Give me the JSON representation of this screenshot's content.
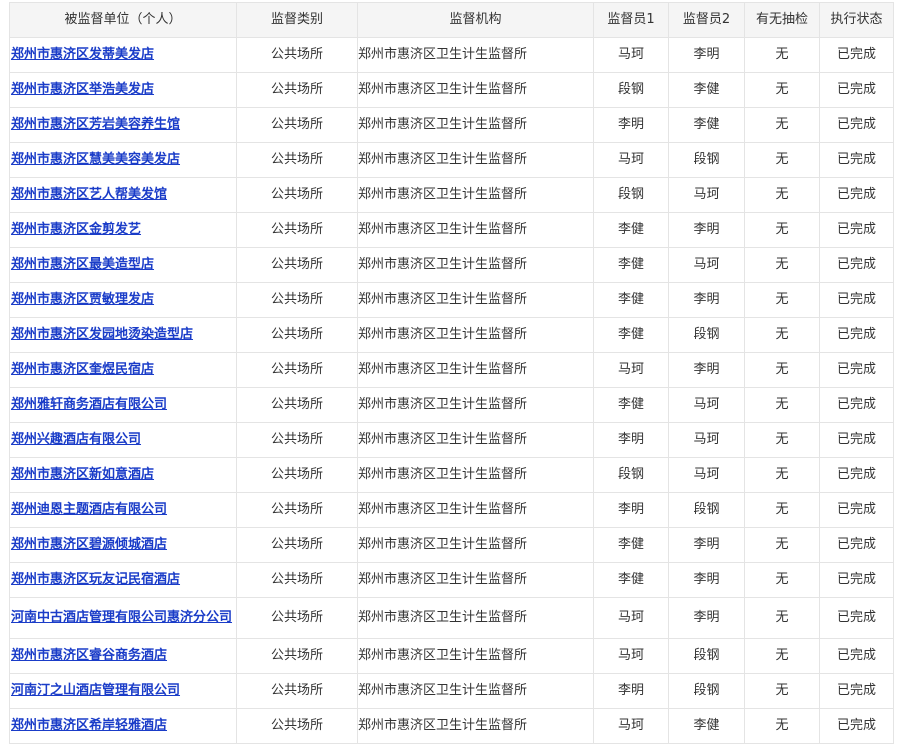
{
  "headers": [
    "被监督单位（个人）",
    "监督类别",
    "监督机构",
    "监督员1",
    "监督员2",
    "有无抽检",
    "执行状态"
  ],
  "rows": [
    {
      "name": "郑州市惠济区发蒂美发店",
      "category": "公共场所",
      "org": "郑州市惠济区卫生计生监督所",
      "inspector1": "马珂",
      "inspector2": "李明",
      "sampling": "无",
      "status": "已完成"
    },
    {
      "name": "郑州市惠济区举浩美发店",
      "category": "公共场所",
      "org": "郑州市惠济区卫生计生监督所",
      "inspector1": "段钢",
      "inspector2": "李健",
      "sampling": "无",
      "status": "已完成"
    },
    {
      "name": "郑州市惠济区芳岩美容养生馆",
      "category": "公共场所",
      "org": "郑州市惠济区卫生计生监督所",
      "inspector1": "李明",
      "inspector2": "李健",
      "sampling": "无",
      "status": "已完成"
    },
    {
      "name": "郑州市惠济区慧美美容美发店",
      "category": "公共场所",
      "org": "郑州市惠济区卫生计生监督所",
      "inspector1": "马珂",
      "inspector2": "段钢",
      "sampling": "无",
      "status": "已完成"
    },
    {
      "name": "郑州市惠济区艺人帮美发馆",
      "category": "公共场所",
      "org": "郑州市惠济区卫生计生监督所",
      "inspector1": "段钢",
      "inspector2": "马珂",
      "sampling": "无",
      "status": "已完成"
    },
    {
      "name": "郑州市惠济区金剪发艺",
      "category": "公共场所",
      "org": "郑州市惠济区卫生计生监督所",
      "inspector1": "李健",
      "inspector2": "李明",
      "sampling": "无",
      "status": "已完成"
    },
    {
      "name": "郑州市惠济区最美造型店",
      "category": "公共场所",
      "org": "郑州市惠济区卫生计生监督所",
      "inspector1": "李健",
      "inspector2": "马珂",
      "sampling": "无",
      "status": "已完成"
    },
    {
      "name": "郑州市惠济区贾敏理发店",
      "category": "公共场所",
      "org": "郑州市惠济区卫生计生监督所",
      "inspector1": "李健",
      "inspector2": "李明",
      "sampling": "无",
      "status": "已完成"
    },
    {
      "name": "郑州市惠济区发园地烫染造型店",
      "category": "公共场所",
      "org": "郑州市惠济区卫生计生监督所",
      "inspector1": "李健",
      "inspector2": "段钢",
      "sampling": "无",
      "status": "已完成"
    },
    {
      "name": "郑州市惠济区奎煜民宿店",
      "category": "公共场所",
      "org": "郑州市惠济区卫生计生监督所",
      "inspector1": "马珂",
      "inspector2": "李明",
      "sampling": "无",
      "status": "已完成"
    },
    {
      "name": "郑州雅轩商务酒店有限公司",
      "category": "公共场所",
      "org": "郑州市惠济区卫生计生监督所",
      "inspector1": "李健",
      "inspector2": "马珂",
      "sampling": "无",
      "status": "已完成"
    },
    {
      "name": "郑州兴趣酒店有限公司",
      "category": "公共场所",
      "org": "郑州市惠济区卫生计生监督所",
      "inspector1": "李明",
      "inspector2": "马珂",
      "sampling": "无",
      "status": "已完成"
    },
    {
      "name": "郑州市惠济区新如意酒店",
      "category": "公共场所",
      "org": "郑州市惠济区卫生计生监督所",
      "inspector1": "段钢",
      "inspector2": "马珂",
      "sampling": "无",
      "status": "已完成"
    },
    {
      "name": "郑州迪恩主题酒店有限公司",
      "category": "公共场所",
      "org": "郑州市惠济区卫生计生监督所",
      "inspector1": "李明",
      "inspector2": "段钢",
      "sampling": "无",
      "status": "已完成"
    },
    {
      "name": "郑州市惠济区碧源倾城酒店",
      "category": "公共场所",
      "org": "郑州市惠济区卫生计生监督所",
      "inspector1": "李健",
      "inspector2": "李明",
      "sampling": "无",
      "status": "已完成"
    },
    {
      "name": "郑州市惠济区玩友记民宿酒店",
      "category": "公共场所",
      "org": "郑州市惠济区卫生计生监督所",
      "inspector1": "李健",
      "inspector2": "李明",
      "sampling": "无",
      "status": "已完成"
    },
    {
      "name": "河南中古酒店管理有限公司惠济分公司",
      "category": "公共场所",
      "org": "郑州市惠济区卫生计生监督所",
      "inspector1": "马珂",
      "inspector2": "李明",
      "sampling": "无",
      "status": "已完成"
    },
    {
      "name": "郑州市惠济区睿谷商务酒店",
      "category": "公共场所",
      "org": "郑州市惠济区卫生计生监督所",
      "inspector1": "马珂",
      "inspector2": "段钢",
      "sampling": "无",
      "status": "已完成"
    },
    {
      "name": "河南汀之山酒店管理有限公司",
      "category": "公共场所",
      "org": "郑州市惠济区卫生计生监督所",
      "inspector1": "李明",
      "inspector2": "段钢",
      "sampling": "无",
      "status": "已完成"
    },
    {
      "name": "郑州市惠济区希岸轻雅酒店",
      "category": "公共场所",
      "org": "郑州市惠济区卫生计生监督所",
      "inspector1": "马珂",
      "inspector2": "李健",
      "sampling": "无",
      "status": "已完成"
    }
  ]
}
